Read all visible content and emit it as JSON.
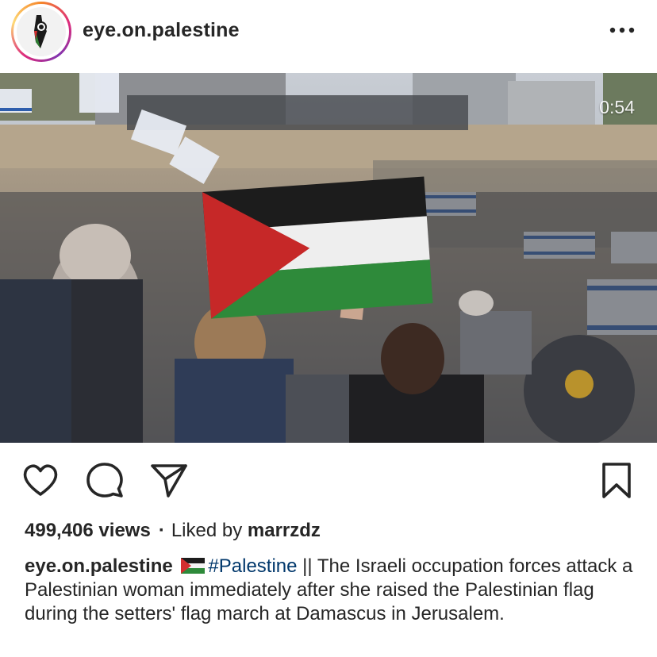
{
  "post": {
    "username": "eye.on.palestine",
    "more_icon": "more-horizontal-icon",
    "video": {
      "time_remaining": "0:54"
    },
    "actions": {
      "like_icon": "heart-icon",
      "comment_icon": "comment-icon",
      "share_icon": "send-icon",
      "save_icon": "bookmark-icon"
    },
    "views": "499,406 views",
    "separator": "·",
    "liked_by_prefix": "Liked by",
    "liked_by_user": "marrzdz",
    "caption": {
      "username": "eye.on.palestine",
      "flag_icon": "palestine-flag-icon",
      "hashtag": "#Palestine",
      "text": " || The Israeli occupation forces attack a Palestinian woman immediately after she raised the Palestinian flag during the setters' flag march at Damascus in Jerusalem."
    }
  },
  "colors": {
    "text": "#262626",
    "hashtag": "#00376b",
    "flag_red": "#d32f2f",
    "flag_green": "#2e7d32"
  }
}
